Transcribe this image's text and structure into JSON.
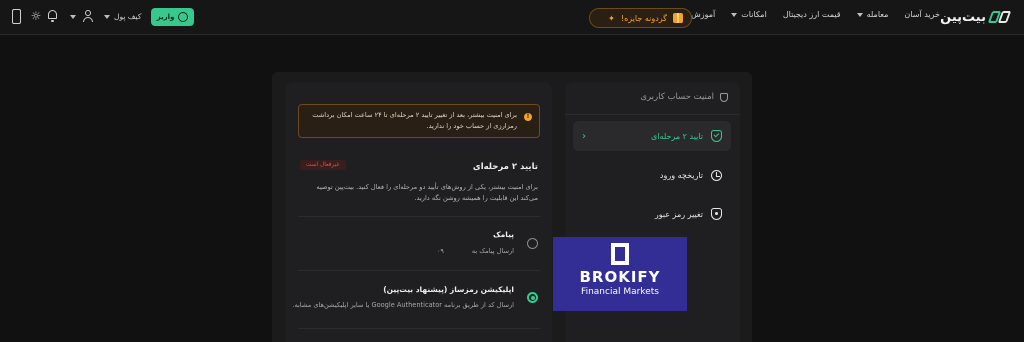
{
  "header": {
    "logo_text": "بیت‌پین",
    "nav": [
      {
        "label": "خرید آسان",
        "has_caret": false
      },
      {
        "label": "معامله",
        "has_caret": true
      },
      {
        "label": "قیمت ارز دیجیتال",
        "has_caret": false
      },
      {
        "label": "امکانات",
        "has_caret": true
      },
      {
        "label": "آموزش",
        "has_caret": true
      }
    ],
    "prize_label": "گردونه جایزه!",
    "deposit_label": "واریز",
    "wallet_label": "کیف پول"
  },
  "sidebar": {
    "title": "امنیت حساب کاربری",
    "items": [
      {
        "label": "تایید ۲ مرحله‌ای",
        "active": true,
        "icon": "shield-check-icon"
      },
      {
        "label": "تاریخچه ورود",
        "active": false,
        "icon": "clock-history-icon"
      },
      {
        "label": "تغییر رمز عبور",
        "active": false,
        "icon": "shield-lock-icon"
      }
    ]
  },
  "main": {
    "alert": "برای امنیت بیشتر، بعد از تغییر تایید ۲ مرحله‌ای تا ۲۴ ساعت امکان برداشت رمزارزی از حساب خود را ندارید.",
    "section_title": "تایید ۲ مرحله‌ای",
    "badge": "غیرفعال است",
    "section_desc": "برای امنیت بیشتر، یکی از روش‌های تأیید دو مرحله‌ای را فعال کنید. بیت‌پین توصیه می‌کند این قابلیت را همیشه روشن نگه دارید.",
    "options": [
      {
        "title": "پیامک",
        "subtitle": "ارسال پیامک به",
        "prefix": "۰۹",
        "selected": false
      },
      {
        "title": "اپلیکیشن رمزساز (پیشنهاد بیت‌پین)",
        "subtitle": "ارسال کد از طریق برنامه Google Authenticator یا سایر اپلیکیشن‌های مشابه.",
        "selected": true
      }
    ]
  },
  "watermark": {
    "name": "BROKIFY",
    "tagline": "Financial Markets"
  },
  "colors": {
    "accent": "#35c98e",
    "warning": "#f2a42d",
    "danger": "#d9534f",
    "watermark_bg": "#332d96"
  }
}
